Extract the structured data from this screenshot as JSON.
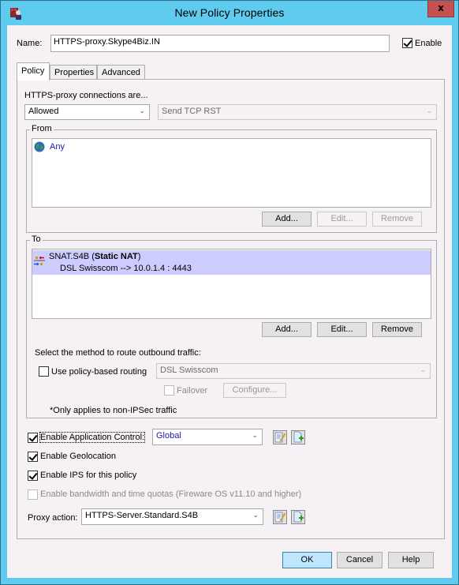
{
  "window": {
    "title": "New Policy Properties",
    "app_icon": "watchguard-user-icon",
    "close_label": "x"
  },
  "name_row": {
    "label": "Name:",
    "value": "HTTPS-proxy.Skype4Biz.IN",
    "enable_label": "Enable",
    "enable_checked": true
  },
  "tabs": [
    {
      "label": "Policy",
      "active": true
    },
    {
      "label": "Properties",
      "active": false
    },
    {
      "label": "Advanced",
      "active": false
    }
  ],
  "policy": {
    "connections_label": "HTTPS-proxy connections are...",
    "connection_action": "Allowed",
    "deny_action": "Send TCP RST",
    "from": {
      "title": "From",
      "items": [
        {
          "icon": "globe-icon",
          "label": "Any"
        }
      ],
      "buttons": {
        "add": "Add...",
        "edit": "Edit...",
        "remove": "Remove"
      }
    },
    "to": {
      "title": "To",
      "items": [
        {
          "icon": "static-nat-icon",
          "name": "SNAT.S4B",
          "type": "Static NAT",
          "paren_open": " (",
          "paren_close": ")",
          "detail": "DSL Swisscom --> 10.0.1.4 : 4443"
        }
      ],
      "buttons": {
        "add": "Add...",
        "edit": "Edit...",
        "remove": "Remove"
      },
      "routing_label": "Select the method to route outbound traffic:",
      "pbr_label": "Use policy-based routing",
      "pbr_checked": false,
      "pbr_interface": "DSL Swisscom",
      "failover_label": "Failover",
      "failover_checked": false,
      "configure_label": "Configure...",
      "note": "*Only applies to non-IPSec traffic"
    },
    "app_control": {
      "label": "Enable Application Control:",
      "checked": true,
      "value": "Global"
    },
    "geolocation": {
      "label": "Enable Geolocation",
      "checked": true
    },
    "ips": {
      "label": "Enable IPS for this policy",
      "checked": true
    },
    "quotas": {
      "label": "Enable bandwidth and time quotas (Fireware OS v11.10 and higher)",
      "checked": false,
      "disabled": true
    },
    "proxy_action": {
      "label": "Proxy action:",
      "value": "HTTPS-Server.Standard.S4B"
    }
  },
  "footer": {
    "ok": "OK",
    "cancel": "Cancel",
    "help": "Help"
  },
  "colors": {
    "titlebar": "#5fcbee",
    "close": "#c75050",
    "selection": "#ccccff",
    "link_blue": "#1a1aa8"
  }
}
